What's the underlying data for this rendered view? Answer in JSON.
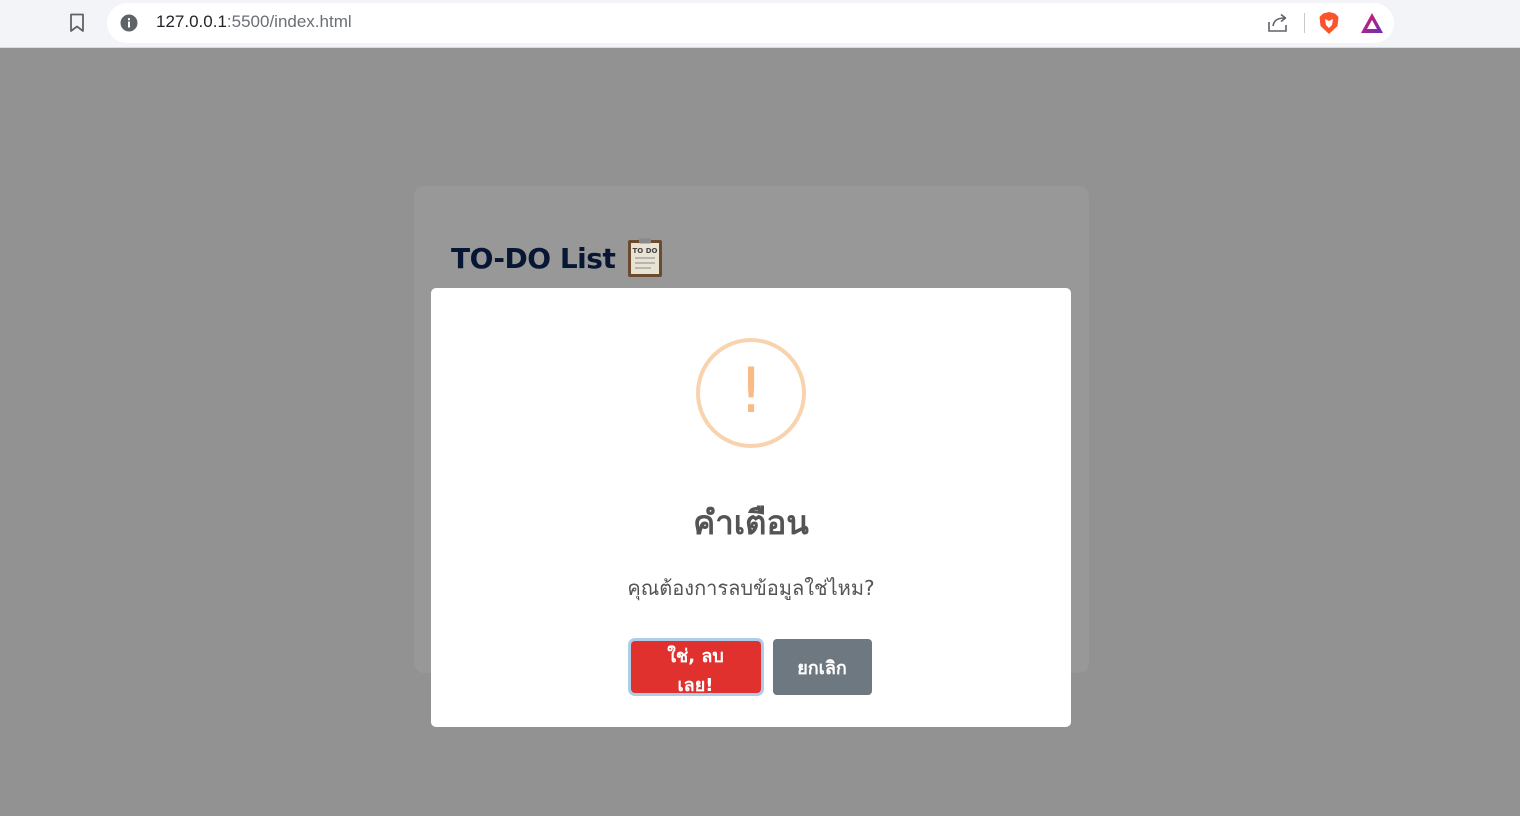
{
  "browser": {
    "url_host": "127.0.0.1",
    "url_path": ":5500/index.html",
    "icons": [
      "bookmark-icon",
      "info-icon",
      "share-icon",
      "brave-shields-icon",
      "brave-rewards-icon"
    ]
  },
  "page": {
    "todo_title": "TO-DO List",
    "todo_icon_text": "TO DO"
  },
  "modal": {
    "icon": "warning-icon",
    "icon_symbol": "!",
    "title": "คำเตือน",
    "text": "คุณต้องการลบข้อมูลใช่ไหม?",
    "confirm_label": "ใช่, ลบเลย!",
    "cancel_label": "ยกเลิก"
  },
  "colors": {
    "overlay": "#929292",
    "confirm": "#e0312f",
    "cancel": "#6e7881",
    "warning": "#f8bb86",
    "title_text": "#061633"
  }
}
